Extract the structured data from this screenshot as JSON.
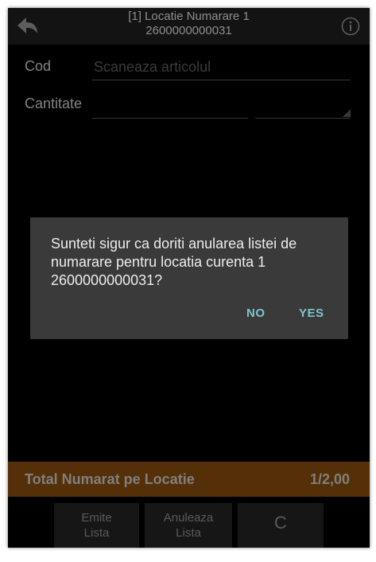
{
  "header": {
    "title_line1": "[1] Locatie Numarare 1",
    "title_line2": "2600000000031",
    "back_icon": "back-arrow-icon",
    "info_icon": "info-icon"
  },
  "form": {
    "cod_label": "Cod",
    "cod_placeholder": "Scaneaza articolul",
    "cod_value": "",
    "cantitate_label": "Cantitate",
    "cantitate_value": "",
    "unit_value": ""
  },
  "dialog": {
    "message": "Sunteti sigur ca doriti anularea listei de numarare pentru locatia curenta 1 2600000000031?",
    "no_label": "NO",
    "yes_label": "YES"
  },
  "total": {
    "label": "Total Numarat pe Locatie",
    "value": "1/2,00"
  },
  "buttons": {
    "emite_line1": "Emite",
    "emite_line2": "Lista",
    "anuleaza_line1": "Anuleaza",
    "anuleaza_line2": "Lista",
    "c_label": "C"
  },
  "colors": {
    "background": "#000000",
    "header": "#1e1e1e",
    "dialog": "#3a3a3a",
    "accent": "#7cc6cc",
    "total_bar": "#83490b"
  }
}
